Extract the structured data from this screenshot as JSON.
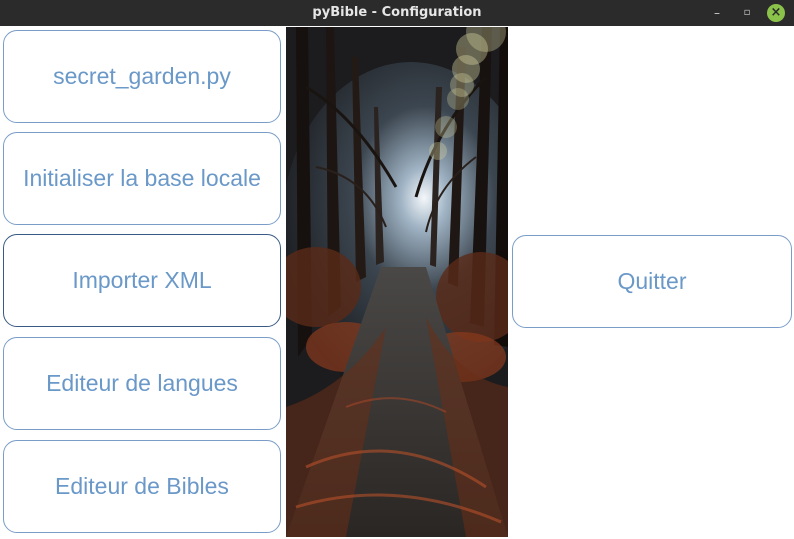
{
  "window": {
    "title": "pyBible - Configuration",
    "minimize_icon": "minimize-icon",
    "maximize_icon": "maximize-icon",
    "close_icon": "close-icon",
    "close_color": "#8bc34a"
  },
  "menu": {
    "buttons": [
      {
        "label": "secret_garden.py"
      },
      {
        "label": "Initialiser la base locale"
      },
      {
        "label": "Importer XML"
      },
      {
        "label": "Editeur de langues"
      },
      {
        "label": "Editeur de Bibles"
      }
    ],
    "quit_label": "Quitter"
  },
  "theme": {
    "button_text_color": "#6a98c8",
    "button_border_color": "#7a9dc8",
    "accent_fire": "#c8502a"
  }
}
